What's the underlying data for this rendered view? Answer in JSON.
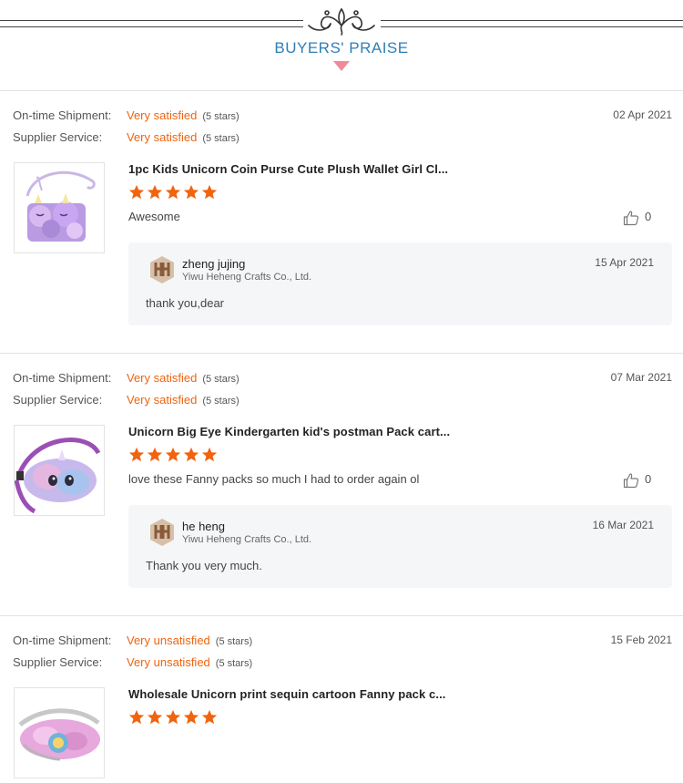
{
  "header": {
    "title": "BUYERS' PRAISE"
  },
  "labels": {
    "shipment": "On-time Shipment:",
    "service": "Supplier Service:"
  },
  "colors": {
    "accent": "#f0640f",
    "title_blue": "#2f7fb7",
    "triangle": "#ee8b9b"
  },
  "reviews": [
    {
      "date": "02 Apr 2021",
      "shipment_rating": "Very satisfied",
      "shipment_stars": "(5 stars)",
      "service_rating": "Very satisfied",
      "service_stars": "(5 stars)",
      "product_title": "1pc Kids Unicorn Coin Purse Cute Plush Wallet Girl Cl...",
      "stars": 5,
      "comment": "Awesome",
      "likes": "0",
      "reply": {
        "name": "zheng jujing",
        "company": "Yiwu Heheng Crafts Co., Ltd.",
        "date": "15 Apr 2021",
        "text": "thank you,dear"
      }
    },
    {
      "date": "07 Mar 2021",
      "shipment_rating": "Very satisfied",
      "shipment_stars": "(5 stars)",
      "service_rating": "Very satisfied",
      "service_stars": "(5 stars)",
      "product_title": "Unicorn Big Eye Kindergarten kid's postman Pack cart...",
      "stars": 5,
      "comment": "love these Fanny packs so much I had to order again  ol",
      "likes": "0",
      "reply": {
        "name": "he heng",
        "company": "Yiwu Heheng Crafts Co., Ltd.",
        "date": "16 Mar 2021",
        "text": "Thank you very much."
      }
    },
    {
      "date": "15 Feb 2021",
      "shipment_rating": "Very unsatisfied",
      "shipment_stars": "(5 stars)",
      "service_rating": "Very unsatisfied",
      "service_stars": "(5 stars)",
      "product_title": "Wholesale Unicorn print sequin cartoon Fanny pack c...",
      "stars": 5
    }
  ]
}
